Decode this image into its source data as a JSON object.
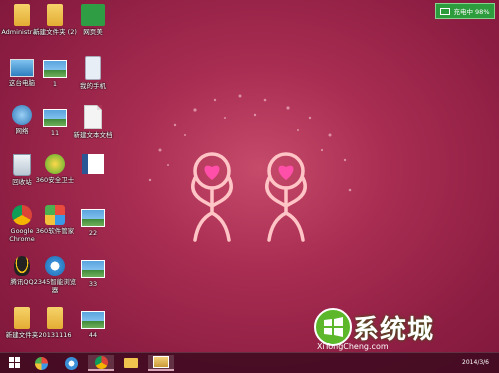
{
  "battery": {
    "label": "充电中 98%"
  },
  "desktop_icons": [
    {
      "label": "Administra..."
    },
    {
      "label": "新建文件夹 (2)"
    },
    {
      "label": "网页美"
    },
    {
      "label": "这台电脑"
    },
    {
      "label": "1"
    },
    {
      "label": "我的手机"
    },
    {
      "label": "网络"
    },
    {
      "label": "11"
    },
    {
      "label": "新建文本文档"
    },
    {
      "label": "回收站"
    },
    {
      "label": "360安全卫士"
    },
    {
      "label": "Google Chrome"
    },
    {
      "label": "360软件管家"
    },
    {
      "label": "22"
    },
    {
      "label": "腾讯QQ"
    },
    {
      "label": "2345智能浏览器"
    },
    {
      "label": "33"
    },
    {
      "label": "新建文件夹"
    },
    {
      "label": "20131116"
    },
    {
      "label": "44"
    }
  ],
  "taskbar": {
    "date": "2014/3/6"
  },
  "watermark": {
    "brand": "系统城",
    "url": "XiTongCheng.com"
  }
}
